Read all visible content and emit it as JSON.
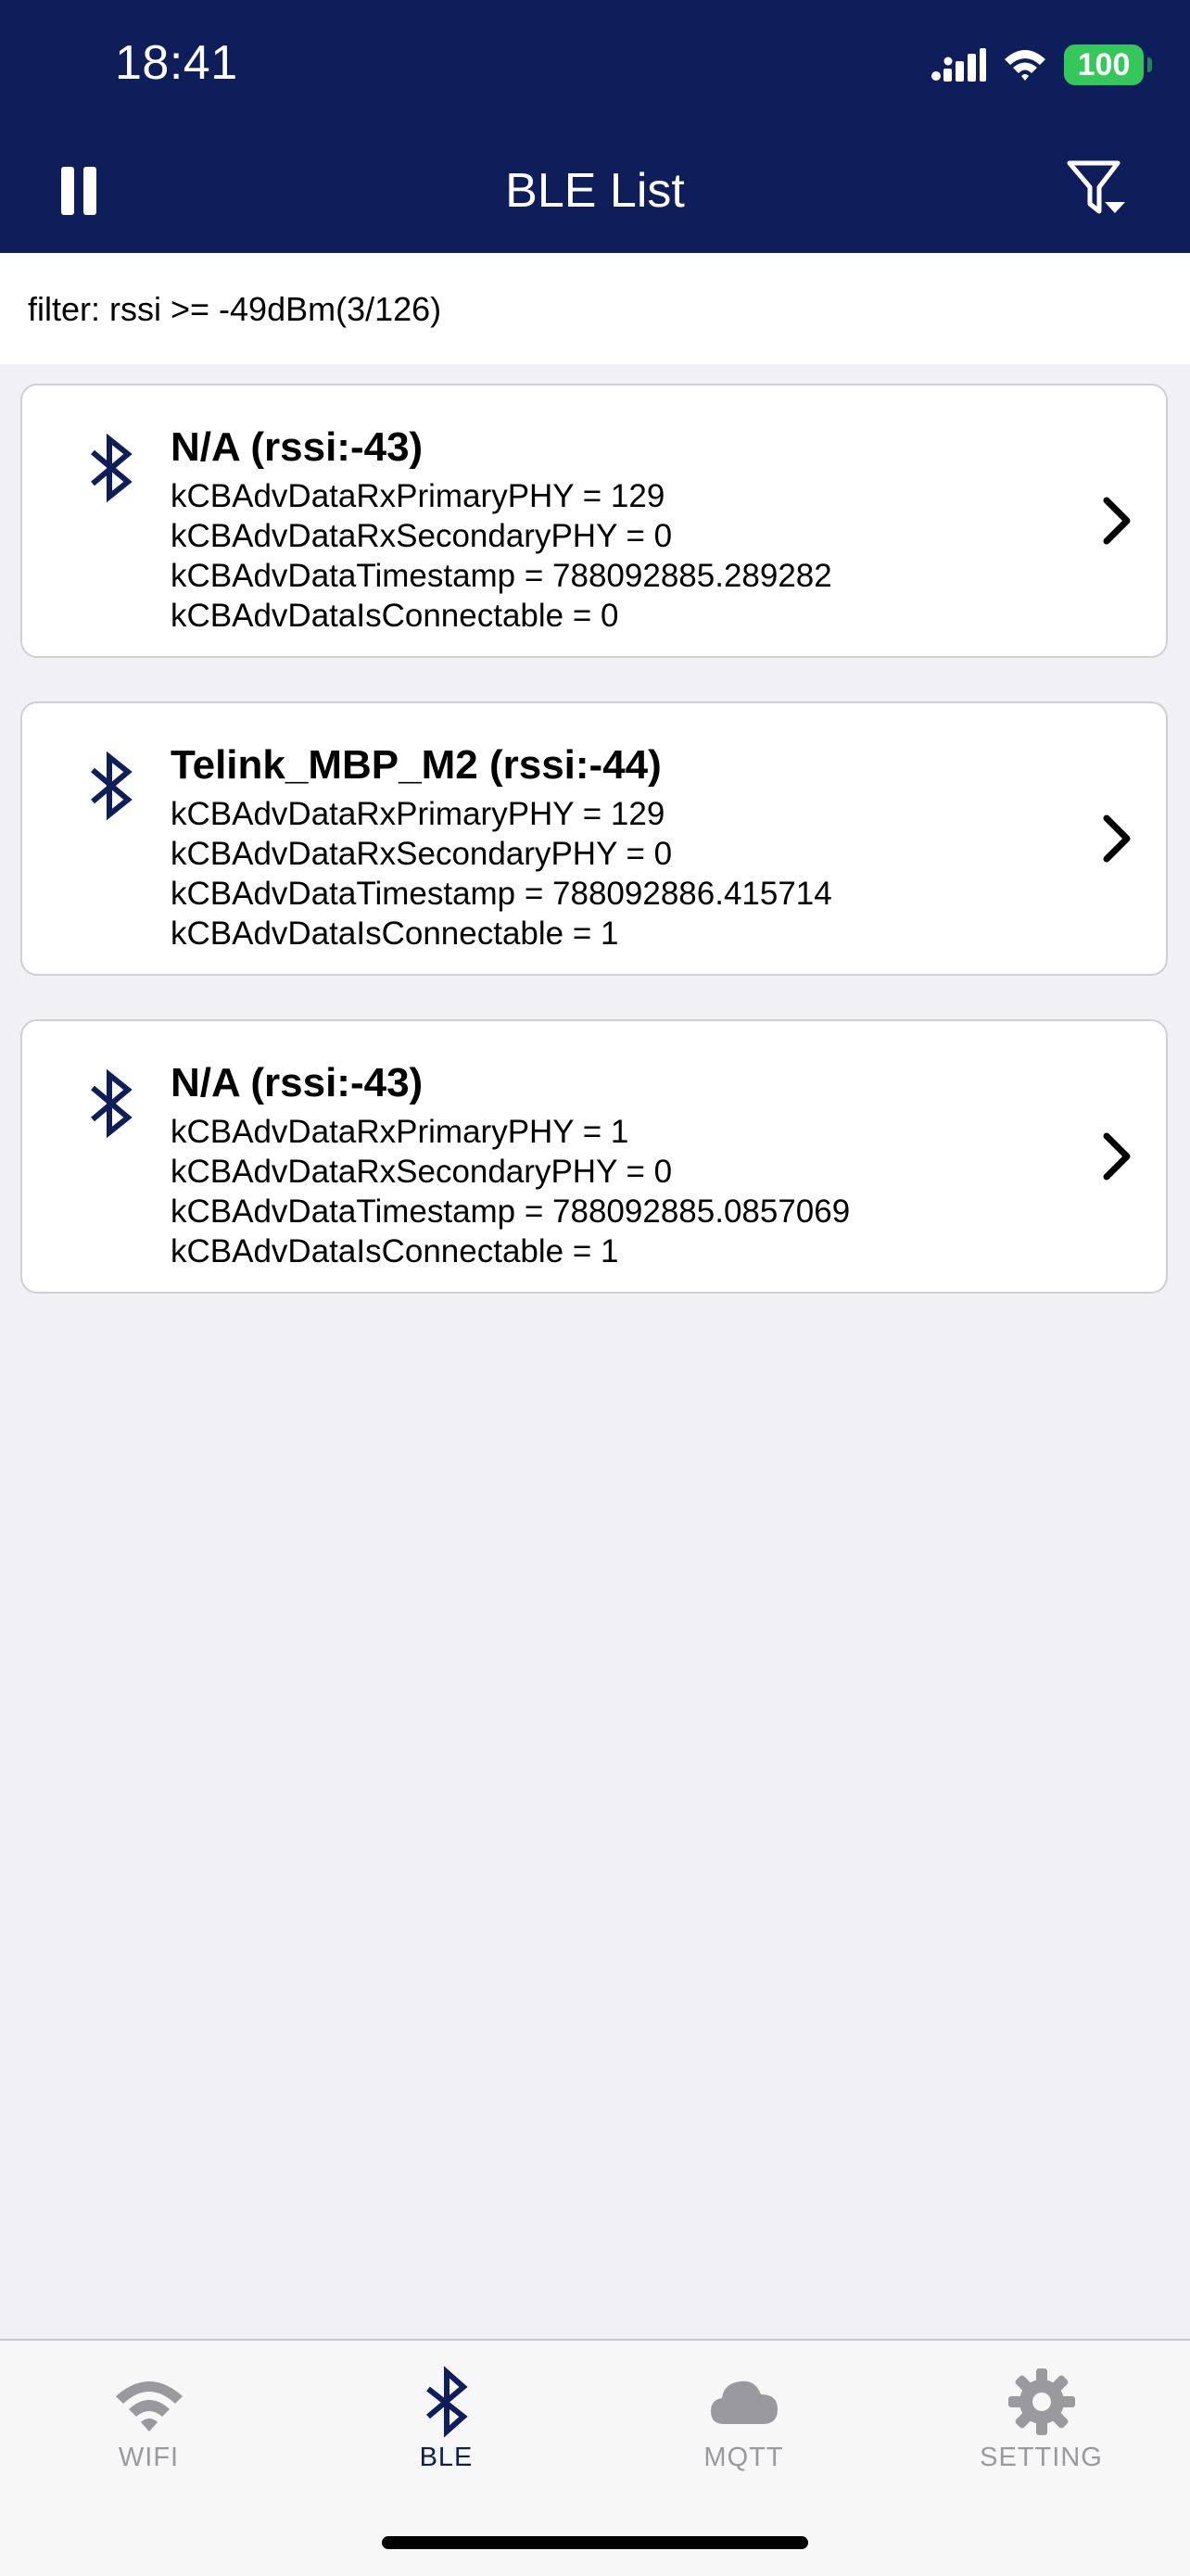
{
  "status": {
    "time": "18:41",
    "battery": "100"
  },
  "nav": {
    "title": "BLE List"
  },
  "filter": {
    "text": "filter: rssi >= -49dBm(3/126)"
  },
  "devices": [
    {
      "name": "N/A (rssi:-43)",
      "lines": [
        "kCBAdvDataRxPrimaryPHY = 129",
        "kCBAdvDataRxSecondaryPHY = 0",
        "kCBAdvDataTimestamp = 788092885.289282",
        "kCBAdvDataIsConnectable = 0"
      ]
    },
    {
      "name": "Telink_MBP_M2 (rssi:-44)",
      "lines": [
        "kCBAdvDataRxPrimaryPHY = 129",
        "kCBAdvDataRxSecondaryPHY = 0",
        "kCBAdvDataTimestamp = 788092886.415714",
        "kCBAdvDataIsConnectable = 1"
      ]
    },
    {
      "name": "N/A (rssi:-43)",
      "lines": [
        "kCBAdvDataRxPrimaryPHY = 1",
        "kCBAdvDataRxSecondaryPHY = 0",
        "kCBAdvDataTimestamp = 788092885.0857069",
        "kCBAdvDataIsConnectable = 1"
      ]
    }
  ],
  "tabs": [
    {
      "label": "WIFI",
      "icon": "wifi-icon"
    },
    {
      "label": "BLE",
      "icon": "bluetooth-icon",
      "active": true
    },
    {
      "label": "MQTT",
      "icon": "cloud-icon"
    },
    {
      "label": "SETTING",
      "icon": "gear-icon"
    }
  ],
  "colors": {
    "header": "#0d1e5b",
    "battery": "#34c759",
    "inactive_tab": "#9a9a9e"
  }
}
